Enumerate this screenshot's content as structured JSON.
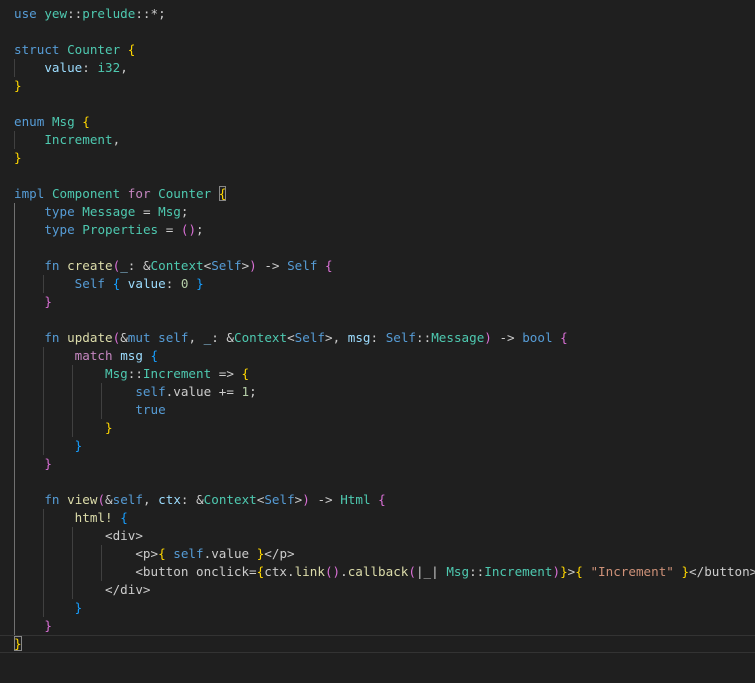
{
  "editor": {
    "theme": {
      "background": "#1f1f1f",
      "keyword": "#569cd6",
      "control": "#c586c0",
      "type": "#4ec9b0",
      "function": "#dcdcaa",
      "variable": "#9cdcfe",
      "number": "#b5cea8",
      "string": "#ce9178",
      "punctuation": "#cccccc",
      "bracket_gold": "#ffd700",
      "bracket_pink": "#da70d6",
      "bracket_blue": "#179fff"
    },
    "lines": [
      {
        "indent": 0,
        "tokens": [
          [
            "use",
            "keyword"
          ],
          [
            " ",
            "punctuation"
          ],
          [
            "yew",
            "type"
          ],
          [
            "::",
            "punctuation"
          ],
          [
            "prelude",
            "type"
          ],
          [
            "::",
            "punctuation"
          ],
          [
            "*;",
            "punctuation"
          ]
        ]
      },
      {
        "indent": 0,
        "tokens": []
      },
      {
        "indent": 0,
        "tokens": [
          [
            "struct",
            "keyword"
          ],
          [
            " ",
            "punctuation"
          ],
          [
            "Counter",
            "type"
          ],
          [
            " ",
            "punctuation"
          ],
          [
            "{",
            "bracket_gold"
          ]
        ]
      },
      {
        "indent": 1,
        "tokens": [
          [
            "    ",
            "punctuation"
          ],
          [
            "value",
            "variable"
          ],
          [
            ": ",
            "punctuation"
          ],
          [
            "i32",
            "type"
          ],
          [
            ",",
            "punctuation"
          ]
        ]
      },
      {
        "indent": 0,
        "tokens": [
          [
            "}",
            "bracket_gold"
          ]
        ]
      },
      {
        "indent": 0,
        "tokens": []
      },
      {
        "indent": 0,
        "tokens": [
          [
            "enum",
            "keyword"
          ],
          [
            " ",
            "punctuation"
          ],
          [
            "Msg",
            "type"
          ],
          [
            " ",
            "punctuation"
          ],
          [
            "{",
            "bracket_gold"
          ]
        ]
      },
      {
        "indent": 1,
        "tokens": [
          [
            "    ",
            "punctuation"
          ],
          [
            "Increment",
            "type"
          ],
          [
            ",",
            "punctuation"
          ]
        ]
      },
      {
        "indent": 0,
        "tokens": [
          [
            "}",
            "bracket_gold"
          ]
        ]
      },
      {
        "indent": 0,
        "tokens": []
      },
      {
        "indent": 0,
        "tokens": [
          [
            "impl",
            "keyword"
          ],
          [
            " ",
            "punctuation"
          ],
          [
            "Component",
            "type"
          ],
          [
            " ",
            "punctuation"
          ],
          [
            "for",
            "control"
          ],
          [
            " ",
            "punctuation"
          ],
          [
            "Counter",
            "type"
          ],
          [
            " ",
            "punctuation"
          ],
          [
            "{",
            "bracket_gold_box"
          ]
        ]
      },
      {
        "indent": 1,
        "tokens": [
          [
            "    ",
            "punctuation"
          ],
          [
            "type",
            "keyword"
          ],
          [
            " ",
            "punctuation"
          ],
          [
            "Message",
            "type"
          ],
          [
            " = ",
            "punctuation"
          ],
          [
            "Msg",
            "type"
          ],
          [
            ";",
            "punctuation"
          ]
        ]
      },
      {
        "indent": 1,
        "tokens": [
          [
            "    ",
            "punctuation"
          ],
          [
            "type",
            "keyword"
          ],
          [
            " ",
            "punctuation"
          ],
          [
            "Properties",
            "type"
          ],
          [
            " = ",
            "punctuation"
          ],
          [
            "()",
            "bracket_pink"
          ],
          [
            ";",
            "punctuation"
          ]
        ]
      },
      {
        "indent": 1,
        "tokens": []
      },
      {
        "indent": 1,
        "tokens": [
          [
            "    ",
            "punctuation"
          ],
          [
            "fn",
            "keyword"
          ],
          [
            " ",
            "punctuation"
          ],
          [
            "create",
            "function"
          ],
          [
            "(",
            "bracket_pink"
          ],
          [
            "_",
            "variable"
          ],
          [
            ": &",
            "punctuation"
          ],
          [
            "Context",
            "type"
          ],
          [
            "<",
            "punctuation"
          ],
          [
            "Self",
            "keyword"
          ],
          [
            ">",
            "punctuation"
          ],
          [
            ")",
            "bracket_pink"
          ],
          [
            " -> ",
            "punctuation"
          ],
          [
            "Self",
            "keyword"
          ],
          [
            " ",
            "punctuation"
          ],
          [
            "{",
            "bracket_pink"
          ]
        ]
      },
      {
        "indent": 2,
        "tokens": [
          [
            "        ",
            "punctuation"
          ],
          [
            "Self",
            "keyword"
          ],
          [
            " ",
            "punctuation"
          ],
          [
            "{",
            "bracket_blue"
          ],
          [
            " ",
            "punctuation"
          ],
          [
            "value",
            "variable"
          ],
          [
            ": ",
            "punctuation"
          ],
          [
            "0",
            "number"
          ],
          [
            " ",
            "punctuation"
          ],
          [
            "}",
            "bracket_blue"
          ]
        ]
      },
      {
        "indent": 1,
        "tokens": [
          [
            "    ",
            "punctuation"
          ],
          [
            "}",
            "bracket_pink"
          ]
        ]
      },
      {
        "indent": 1,
        "tokens": []
      },
      {
        "indent": 1,
        "tokens": [
          [
            "    ",
            "punctuation"
          ],
          [
            "fn",
            "keyword"
          ],
          [
            " ",
            "punctuation"
          ],
          [
            "update",
            "function"
          ],
          [
            "(",
            "bracket_pink"
          ],
          [
            "&",
            "punctuation"
          ],
          [
            "mut",
            "keyword"
          ],
          [
            " ",
            "punctuation"
          ],
          [
            "self",
            "keyword"
          ],
          [
            ", ",
            "punctuation"
          ],
          [
            "_",
            "variable"
          ],
          [
            ": &",
            "punctuation"
          ],
          [
            "Context",
            "type"
          ],
          [
            "<",
            "punctuation"
          ],
          [
            "Self",
            "keyword"
          ],
          [
            ">, ",
            "punctuation"
          ],
          [
            "msg",
            "variable"
          ],
          [
            ": ",
            "punctuation"
          ],
          [
            "Self",
            "keyword"
          ],
          [
            "::",
            "punctuation"
          ],
          [
            "Message",
            "type"
          ],
          [
            ")",
            "bracket_pink"
          ],
          [
            " -> ",
            "punctuation"
          ],
          [
            "bool",
            "keyword"
          ],
          [
            " ",
            "punctuation"
          ],
          [
            "{",
            "bracket_pink"
          ]
        ]
      },
      {
        "indent": 2,
        "tokens": [
          [
            "        ",
            "punctuation"
          ],
          [
            "match",
            "control"
          ],
          [
            " ",
            "punctuation"
          ],
          [
            "msg",
            "variable"
          ],
          [
            " ",
            "punctuation"
          ],
          [
            "{",
            "bracket_blue"
          ]
        ]
      },
      {
        "indent": 3,
        "tokens": [
          [
            "            ",
            "punctuation"
          ],
          [
            "Msg",
            "type"
          ],
          [
            "::",
            "punctuation"
          ],
          [
            "Increment",
            "type"
          ],
          [
            " => ",
            "punctuation"
          ],
          [
            "{",
            "bracket_gold"
          ]
        ]
      },
      {
        "indent": 4,
        "tokens": [
          [
            "                ",
            "punctuation"
          ],
          [
            "self",
            "keyword"
          ],
          [
            ".value += ",
            "punctuation"
          ],
          [
            "1",
            "number"
          ],
          [
            ";",
            "punctuation"
          ]
        ]
      },
      {
        "indent": 4,
        "tokens": [
          [
            "                ",
            "punctuation"
          ],
          [
            "true",
            "keyword"
          ]
        ]
      },
      {
        "indent": 3,
        "tokens": [
          [
            "            ",
            "punctuation"
          ],
          [
            "}",
            "bracket_gold"
          ]
        ]
      },
      {
        "indent": 2,
        "tokens": [
          [
            "        ",
            "punctuation"
          ],
          [
            "}",
            "bracket_blue"
          ]
        ]
      },
      {
        "indent": 1,
        "tokens": [
          [
            "    ",
            "punctuation"
          ],
          [
            "}",
            "bracket_pink"
          ]
        ]
      },
      {
        "indent": 1,
        "tokens": []
      },
      {
        "indent": 1,
        "tokens": [
          [
            "    ",
            "punctuation"
          ],
          [
            "fn",
            "keyword"
          ],
          [
            " ",
            "punctuation"
          ],
          [
            "view",
            "function"
          ],
          [
            "(",
            "bracket_pink"
          ],
          [
            "&",
            "punctuation"
          ],
          [
            "self",
            "keyword"
          ],
          [
            ", ",
            "punctuation"
          ],
          [
            "ctx",
            "variable"
          ],
          [
            ": &",
            "punctuation"
          ],
          [
            "Context",
            "type"
          ],
          [
            "<",
            "punctuation"
          ],
          [
            "Self",
            "keyword"
          ],
          [
            ">",
            "punctuation"
          ],
          [
            ")",
            "bracket_pink"
          ],
          [
            " -> ",
            "punctuation"
          ],
          [
            "Html",
            "type"
          ],
          [
            " ",
            "punctuation"
          ],
          [
            "{",
            "bracket_pink"
          ]
        ]
      },
      {
        "indent": 2,
        "tokens": [
          [
            "        ",
            "punctuation"
          ],
          [
            "html!",
            "function"
          ],
          [
            " ",
            "punctuation"
          ],
          [
            "{",
            "bracket_blue"
          ]
        ]
      },
      {
        "indent": 3,
        "tokens": [
          [
            "            ",
            "punctuation"
          ],
          [
            "<div>",
            "punctuation"
          ]
        ]
      },
      {
        "indent": 4,
        "tokens": [
          [
            "                ",
            "punctuation"
          ],
          [
            "<p>",
            "punctuation"
          ],
          [
            "{",
            "bracket_gold"
          ],
          [
            " ",
            "punctuation"
          ],
          [
            "self",
            "keyword"
          ],
          [
            ".value ",
            "punctuation"
          ],
          [
            "}",
            "bracket_gold"
          ],
          [
            "</p>",
            "punctuation"
          ]
        ]
      },
      {
        "indent": 4,
        "tokens": [
          [
            "                ",
            "punctuation"
          ],
          [
            "<button onclick=",
            "punctuation"
          ],
          [
            "{",
            "bracket_gold"
          ],
          [
            "ctx",
            "punctuation"
          ],
          [
            ".",
            "punctuation"
          ],
          [
            "link",
            "function"
          ],
          [
            "()",
            "bracket_pink"
          ],
          [
            ".",
            "punctuation"
          ],
          [
            "callback",
            "function"
          ],
          [
            "(",
            "bracket_pink"
          ],
          [
            "|_|",
            "punctuation"
          ],
          [
            " ",
            "punctuation"
          ],
          [
            "Msg",
            "type"
          ],
          [
            "::",
            "punctuation"
          ],
          [
            "Increment",
            "type"
          ],
          [
            ")",
            "bracket_pink"
          ],
          [
            "}",
            "bracket_gold"
          ],
          [
            ">",
            "punctuation"
          ],
          [
            "{",
            "bracket_gold"
          ],
          [
            " ",
            "punctuation"
          ],
          [
            "\"Increment\"",
            "string"
          ],
          [
            " ",
            "punctuation"
          ],
          [
            "}",
            "bracket_gold"
          ],
          [
            "</button>",
            "punctuation"
          ]
        ]
      },
      {
        "indent": 3,
        "tokens": [
          [
            "            ",
            "punctuation"
          ],
          [
            "</div>",
            "punctuation"
          ]
        ]
      },
      {
        "indent": 2,
        "tokens": [
          [
            "        ",
            "punctuation"
          ],
          [
            "}",
            "bracket_blue"
          ]
        ]
      },
      {
        "indent": 1,
        "tokens": [
          [
            "    ",
            "punctuation"
          ],
          [
            "}",
            "bracket_pink"
          ]
        ]
      },
      {
        "indent": 0,
        "tokens": [
          [
            "}",
            "bracket_gold_box"
          ]
        ]
      }
    ]
  }
}
